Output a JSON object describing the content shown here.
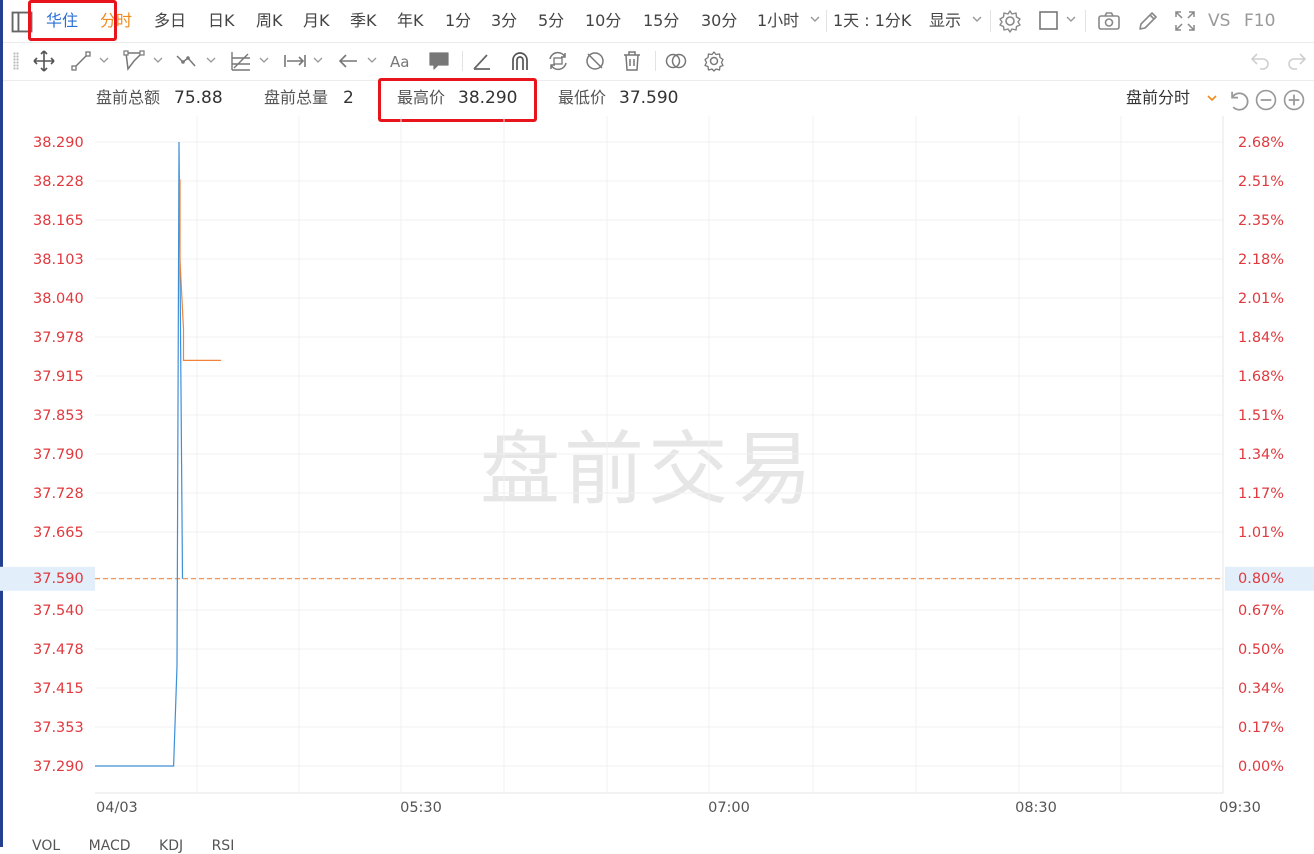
{
  "toolbar": {
    "stock_name": "华住",
    "tabs": [
      "分时",
      "多日",
      "日K",
      "周K",
      "月K",
      "季K",
      "年K",
      "1分",
      "3分",
      "5分",
      "10分",
      "15分",
      "30分",
      "1小时"
    ],
    "period_select": "1天 : 1分K",
    "display_label": "显示",
    "vs_label": "VS",
    "f10_label": "F10"
  },
  "info": {
    "premarket_amount_label": "盘前总额",
    "premarket_amount": "75.88",
    "premarket_volume_label": "盘前总量",
    "premarket_volume": "2",
    "high_label": "最高价",
    "high": "38.290",
    "low_label": "最低价",
    "low": "37.590",
    "session_select": "盘前分时"
  },
  "watermark": "盘前交易",
  "bottom_tabs": [
    "VOL",
    "MACD",
    "KDJ",
    "RSI"
  ],
  "colors": {
    "accent_blue": "#2a6fd6",
    "orange": "#f08a1c",
    "axis_red": "#e0393e",
    "price_line": "#3d8fd6",
    "avg_line": "#f0823a",
    "highlight_box": "#e8141b"
  },
  "chart_data": {
    "type": "line",
    "y_left_ticks": [
      "38.290",
      "38.228",
      "38.165",
      "38.103",
      "38.040",
      "37.978",
      "37.915",
      "37.853",
      "37.790",
      "37.728",
      "37.665",
      "37.590",
      "37.540",
      "37.478",
      "37.415",
      "37.353",
      "37.290"
    ],
    "y_right_ticks": [
      "2.68%",
      "2.51%",
      "2.35%",
      "2.18%",
      "2.01%",
      "1.84%",
      "1.68%",
      "1.51%",
      "1.34%",
      "1.17%",
      "1.01%",
      "0.80%",
      "0.67%",
      "0.50%",
      "0.34%",
      "0.17%",
      "0.00%"
    ],
    "x_ticks": [
      "04/03",
      "05:30",
      "07:00",
      "08:30",
      "09:30"
    ],
    "ylim": [
      37.29,
      38.29
    ],
    "current_price": "37.590",
    "current_pct": "0.80%",
    "series": [
      {
        "x": [
          "04:00",
          "04:23",
          "04:24",
          "04:24",
          "04:25",
          "04:25"
        ],
        "values": [
          37.29,
          37.29,
          37.45,
          38.29,
          37.59,
          37.59
        ]
      },
      {
        "x": [
          "04:24",
          "04:24",
          "04:25",
          "04:25",
          "04:36"
        ],
        "values": [
          38.23,
          38.1,
          37.99,
          37.94,
          37.94
        ]
      }
    ]
  }
}
